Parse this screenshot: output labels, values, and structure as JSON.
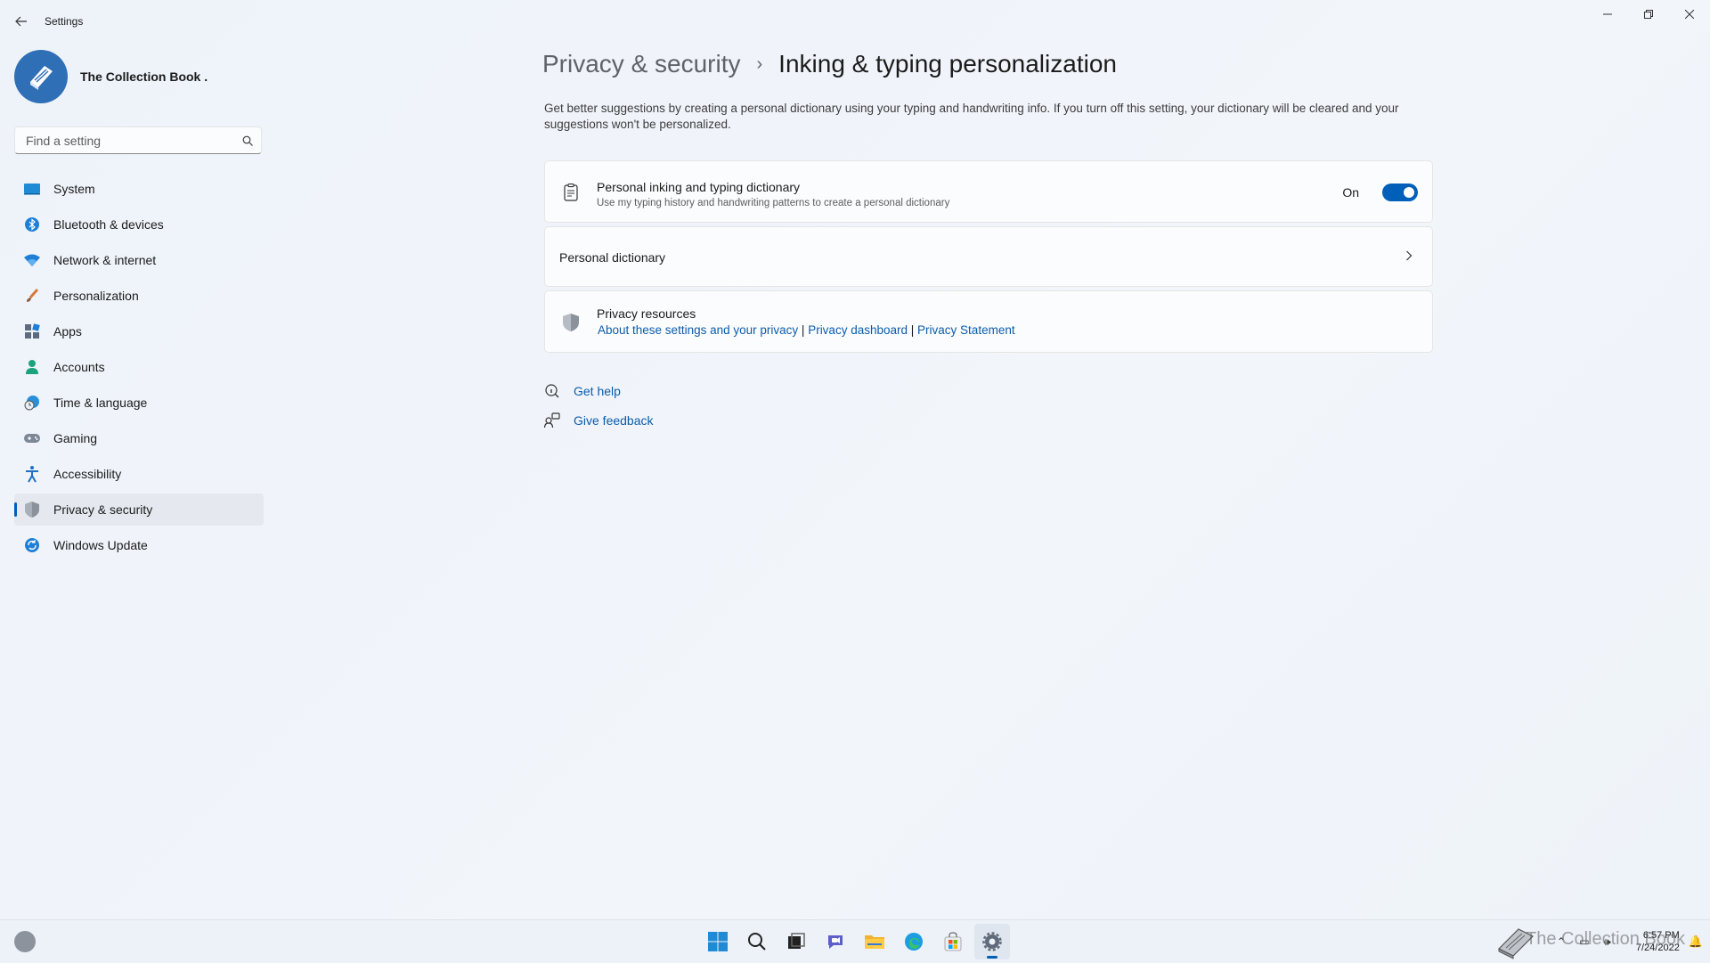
{
  "window": {
    "app_title": "Settings"
  },
  "profile": {
    "name": "The Collection Book ."
  },
  "search": {
    "placeholder": "Find a setting"
  },
  "sidebar": {
    "items": [
      {
        "label": "System",
        "icon": "system-icon"
      },
      {
        "label": "Bluetooth & devices",
        "icon": "bluetooth-icon"
      },
      {
        "label": "Network & internet",
        "icon": "wifi-icon"
      },
      {
        "label": "Personalization",
        "icon": "brush-icon"
      },
      {
        "label": "Apps",
        "icon": "apps-icon"
      },
      {
        "label": "Accounts",
        "icon": "person-icon"
      },
      {
        "label": "Time & language",
        "icon": "globe-clock-icon"
      },
      {
        "label": "Gaming",
        "icon": "gamepad-icon"
      },
      {
        "label": "Accessibility",
        "icon": "accessibility-icon"
      },
      {
        "label": "Privacy & security",
        "icon": "shield-icon",
        "active": true
      },
      {
        "label": "Windows Update",
        "icon": "update-icon"
      }
    ]
  },
  "breadcrumb": {
    "parent": "Privacy & security",
    "separator": "›",
    "current": "Inking & typing personalization"
  },
  "main": {
    "description": "Get better suggestions by creating a personal dictionary using your typing and handwriting info. If you turn off this setting, your dictionary will be cleared and your suggestions won't be personalized.",
    "dictionary_card": {
      "title": "Personal inking and typing dictionary",
      "subtitle": "Use my typing history and handwriting patterns to create a personal dictionary",
      "toggle_label": "On",
      "toggle_on": true
    },
    "personal_dictionary": {
      "label": "Personal dictionary"
    },
    "privacy_resources": {
      "title": "Privacy resources",
      "link_about": "About these settings and your privacy",
      "link_dashboard": "Privacy dashboard",
      "link_statement": "Privacy Statement",
      "divider": "|"
    },
    "help": {
      "get_help": "Get help",
      "give_feedback": "Give feedback"
    }
  },
  "taskbar": {
    "apps": [
      "start-icon",
      "search-icon",
      "task-view-icon",
      "chat-icon",
      "file-explorer-icon",
      "edge-icon",
      "store-icon",
      "settings-icon"
    ],
    "watermark": "The Collection Book",
    "time": "6:57 PM",
    "date": "7/24/2022"
  },
  "colors": {
    "accent": "#005fb8",
    "link": "#0b5cab"
  }
}
